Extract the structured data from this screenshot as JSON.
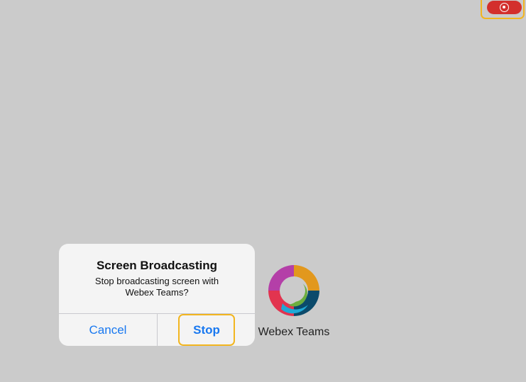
{
  "status_bar": {
    "recording_icon": "screen-record-icon",
    "recording_color": "#d32f2c"
  },
  "alert": {
    "title": "Screen Broadcasting",
    "message": "Stop broadcasting screen with Webex Teams?",
    "cancel_label": "Cancel",
    "stop_label": "Stop",
    "button_color": "#1878f0"
  },
  "app": {
    "label": "Webex Teams",
    "icon": "webex-teams-icon"
  },
  "highlight_color": "#f2b51f"
}
